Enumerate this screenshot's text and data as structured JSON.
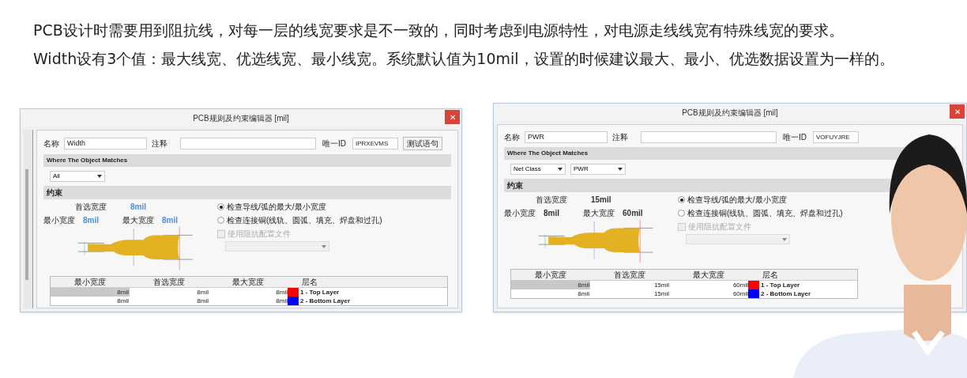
{
  "intro": [
    "PCB设计时需要用到阻抗线，对每一层的线宽要求是不一致的，同时考虑到电源特性，对电源走线线宽有特殊线宽的要求。",
    "Width设有3个值：最大线宽、优选线宽、最小线宽。系统默认值为10mil，设置的时候建议最大、最小、优选数据设置为一样的。"
  ],
  "dialogs": [
    {
      "title": "PCB规则及约束编辑器 [mil]",
      "close": "✕",
      "side_panel": true,
      "name_label": "名称",
      "name": "Width",
      "comment_label": "注释",
      "uid_label": "唯一ID",
      "uid": "IPRXEVMS",
      "test_button": "测试语句",
      "match_header": "Where The Object Matches",
      "conditions": [
        "All"
      ],
      "constraint_header": "约束",
      "preferred_label": "首选宽度",
      "preferred": "8mil",
      "min_label": "最小宽度",
      "min": "8mil",
      "max_label": "最大宽度",
      "max": "8mil",
      "color": "#4a90d9",
      "radios": [
        {
          "label": "检查导线/弧的最大/最小宽度",
          "selected": true
        },
        {
          "label": "检查连接铜(线轨、圆弧、填充、焊盘和过孔)",
          "selected": false
        }
      ],
      "checkbox": {
        "label": "使用阻抗配置文件",
        "checked": false,
        "disabled": true
      },
      "columns": [
        "最小宽度",
        "首选宽度",
        "最大宽度",
        "层名"
      ],
      "rows": [
        {
          "min": "8mil",
          "preferred": "8mil",
          "max": "8mil",
          "layer": "1 - Top Layer",
          "color": "#ff0000",
          "selected": true
        },
        {
          "min": "8mil",
          "preferred": "8mil",
          "max": "8mil",
          "layer": "2 - Bottom Layer",
          "color": "#0000ff",
          "selected": false
        }
      ]
    },
    {
      "title": "PCB规则及约束编辑器 [mil]",
      "close": "✕",
      "side_panel": false,
      "name_label": "名称",
      "name": "PWR",
      "comment_label": "注释",
      "uid_label": "唯一ID",
      "uid": "VOFUYJRE",
      "match_header": "Where The Object Matches",
      "conditions": [
        "Net Class",
        "PWR"
      ],
      "constraint_header": "约束",
      "preferred_label": "首选宽度",
      "preferred": "15mil",
      "min_label": "最小宽度",
      "min": "8mil",
      "max_label": "最大宽度",
      "max": "60mil",
      "color": "#333333",
      "radios": [
        {
          "label": "检查导线/弧的最大/最小宽度",
          "selected": true
        },
        {
          "label": "检查连接铜(线轨、圆弧、填充、焊盘和过孔)",
          "selected": false
        }
      ],
      "checkbox": {
        "label": "使用阻抗配置文件",
        "checked": false,
        "disabled": true
      },
      "columns": [
        "最小宽度",
        "首选宽度",
        "最大宽度",
        "层名"
      ],
      "rows": [
        {
          "min": "8mil",
          "preferred": "15mil",
          "max": "60mil",
          "layer": "1 - Top Layer",
          "color": "#ff0000",
          "selected": true
        },
        {
          "min": "8mil",
          "preferred": "15mil",
          "max": "60mil",
          "layer": "2 - Bottom Layer",
          "color": "#0000ff",
          "selected": false
        }
      ]
    }
  ]
}
